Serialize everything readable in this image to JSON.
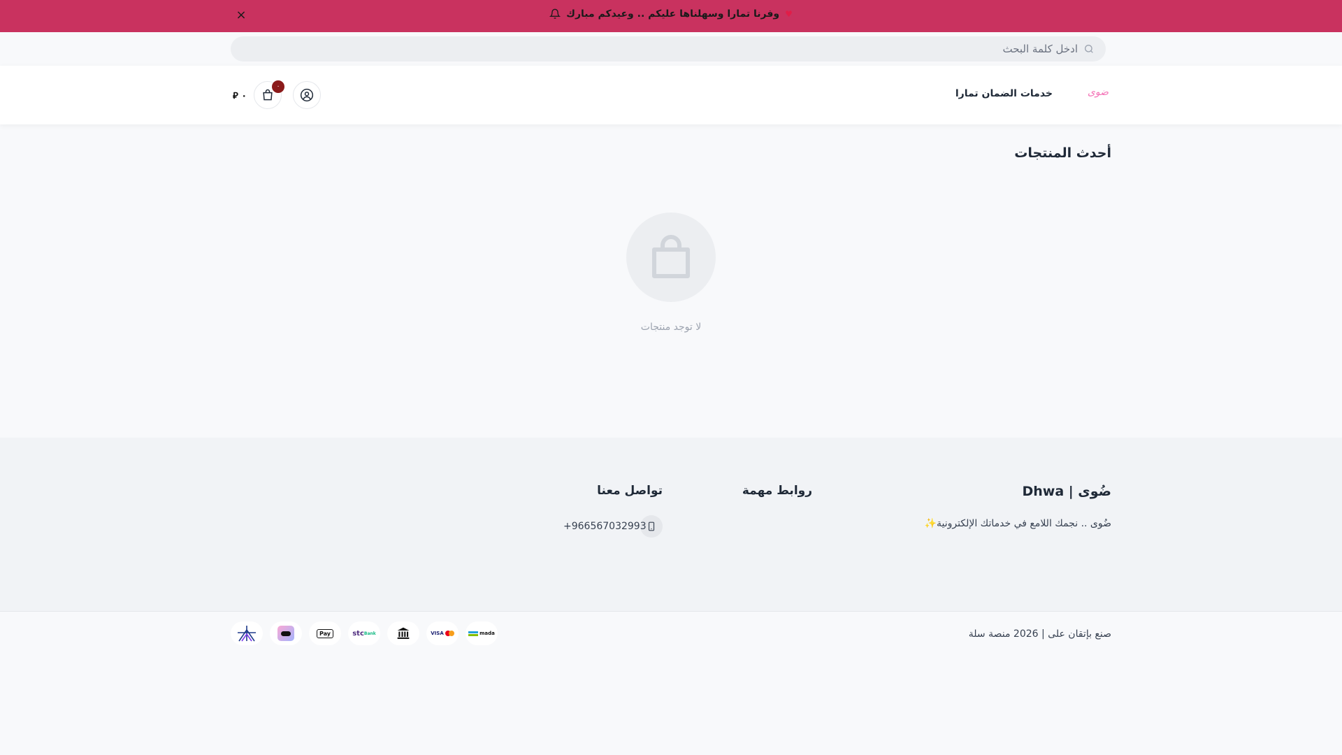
{
  "announcement": {
    "text": "وفرنا تمارا وسهلناها عليكم .. وعيدكم مبارك",
    "close": "×",
    "heart": "♥"
  },
  "search": {
    "placeholder": "ادخل كلمة البحث"
  },
  "header": {
    "logo": "ضوى",
    "nav": [
      "خدمات الضمان تمارا"
    ],
    "cart_count": "٠",
    "cart_total": "٠ ⃁"
  },
  "main": {
    "section_title": "أحدث المنتجات",
    "empty_message": "لا توجد منتجات"
  },
  "footer": {
    "brand": "ضُوى | Dhwa",
    "description": "ضُوى .. نجمك اللامع في خدماتك الإلكترونية✨",
    "links_title": "روابط مهمة",
    "contact_title": "تواصل معنا",
    "phone": "+966567032993",
    "copyright": "صنع بإتقان على | 2026 منصة سلة",
    "payment_methods": [
      "mada",
      "visa-mastercard",
      "bank",
      "stc-bank",
      "apple-pay",
      "tabby",
      "tamara"
    ],
    "payment_labels": {
      "mada": "mada",
      "visa": "VISA",
      "stc": "stc",
      "stc_bank": "Bank",
      "apple_pay": "Pay"
    }
  },
  "colors": {
    "announcement_bg": "#c9325f",
    "logo": "#f472b6",
    "badge": "#8b1a1a"
  }
}
